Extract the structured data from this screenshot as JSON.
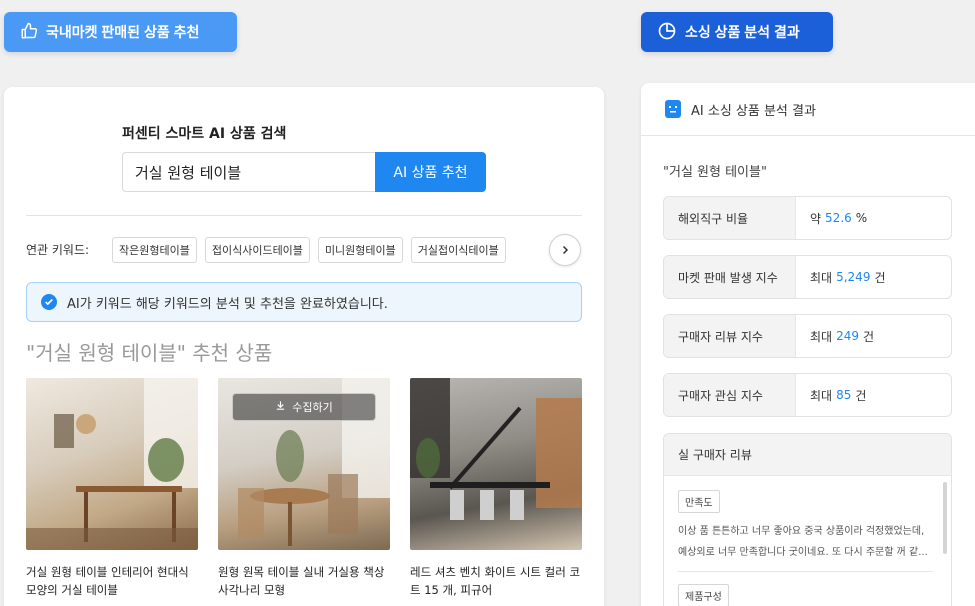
{
  "top_buttons": {
    "left": {
      "label": "국내마켓 판매된 상품 추천",
      "icon": "thumbs-up-icon"
    },
    "right": {
      "label": "소싱 상품 분석 결과",
      "icon": "pie-chart-icon"
    }
  },
  "search": {
    "title": "퍼센티 스마트 AI 상품 검색",
    "value": "거실 원형 테이블",
    "button_label": "AI 상품 추천"
  },
  "keywords": {
    "label": "연관 키워드:",
    "items": [
      "작은원형테이블",
      "접이식사이드테이블",
      "미니원형테이블",
      "거실접이식테이블"
    ]
  },
  "notice": {
    "text": "AI가 키워드 해당 키워드의 분석 및 추천을 완료하였습니다."
  },
  "recommend_title": "\"거실 원형 테이블\" 추천 상품",
  "products": [
    {
      "name": "거실 원형 테이블 인테리어 현대식 모양의 거실 테이블"
    },
    {
      "name": "원형 원목 테이블 실내 거실용 책상 사각나리 모형",
      "collect_label": "수집하기"
    },
    {
      "name": "레드 셔츠 벤치 화이트 시트 컬러 코트 15 개, 피규어"
    }
  ],
  "analysis": {
    "header": "AI 소싱 상품 분석 결과",
    "query": "\"거실 원형 테이블\"",
    "metrics": [
      {
        "label": "해외직구 비율",
        "prefix": "약",
        "value": "52.6",
        "unit": "%"
      },
      {
        "label": "마켓 판매 발생 지수",
        "prefix": "최대",
        "value": "5,249",
        "unit": "건"
      },
      {
        "label": "구매자 리뷰 지수",
        "prefix": "최대",
        "value": "249",
        "unit": "건"
      },
      {
        "label": "구매자 관심 지수",
        "prefix": "최대",
        "value": "85",
        "unit": "건"
      }
    ],
    "reviews": {
      "header": "실 구매자 리뷰",
      "items": [
        {
          "tag": "만족도",
          "text": "이상 품 튼튼하고 너무 좋아요 중국 상품이라 걱정했었는데, 예상외로 너무 만족합니다 굿이네요. 또 다시 주문할 꺼 같..."
        },
        {
          "tag": "제품구성",
          "text": ""
        }
      ]
    }
  },
  "colors": {
    "accent": "#1e88f0",
    "button_left": "#4a9af5",
    "button_right": "#1b5fd9"
  }
}
